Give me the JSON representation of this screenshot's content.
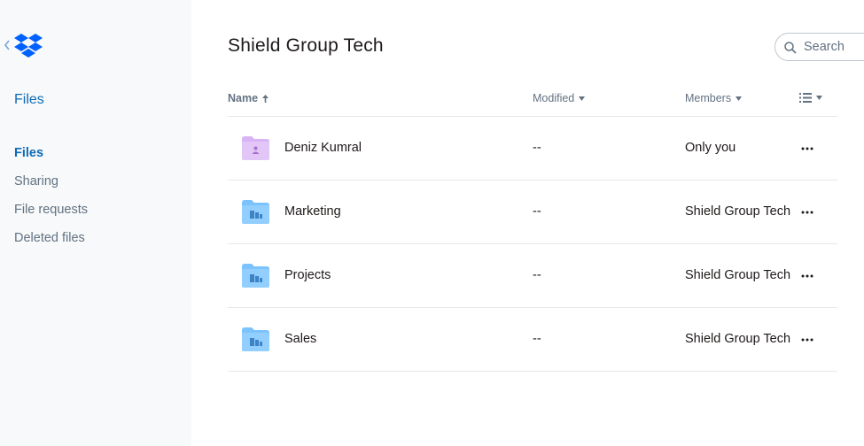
{
  "sidebar": {
    "title": "Files",
    "nav": [
      {
        "label": "Files",
        "active": true
      },
      {
        "label": "Sharing",
        "active": false
      },
      {
        "label": "File requests",
        "active": false
      },
      {
        "label": "Deleted files",
        "active": false
      }
    ]
  },
  "header": {
    "title": "Shield Group Tech",
    "search_placeholder": "Search"
  },
  "table": {
    "columns": {
      "name": "Name",
      "modified": "Modified",
      "members": "Members"
    },
    "rows": [
      {
        "name": "Deniz Kumral",
        "modified": "--",
        "members": "Only you",
        "folder_type": "personal"
      },
      {
        "name": "Marketing",
        "modified": "--",
        "members": "Shield Group Tech",
        "folder_type": "team"
      },
      {
        "name": "Projects",
        "modified": "--",
        "members": "Shield Group Tech",
        "folder_type": "team"
      },
      {
        "name": "Sales",
        "modified": "--",
        "members": "Shield Group Tech",
        "folder_type": "team"
      }
    ]
  },
  "colors": {
    "brand_blue": "#0061ff",
    "link_blue": "#0f6bb5",
    "team_folder": "#92cefe",
    "personal_folder": "#d8b4f4"
  },
  "icons": [
    "chevron-left-icon",
    "dropbox-logo",
    "search-icon",
    "sort-arrow-up-icon",
    "caret-down-icon",
    "list-view-icon",
    "folder-personal-icon",
    "folder-team-icon",
    "more-icon"
  ]
}
